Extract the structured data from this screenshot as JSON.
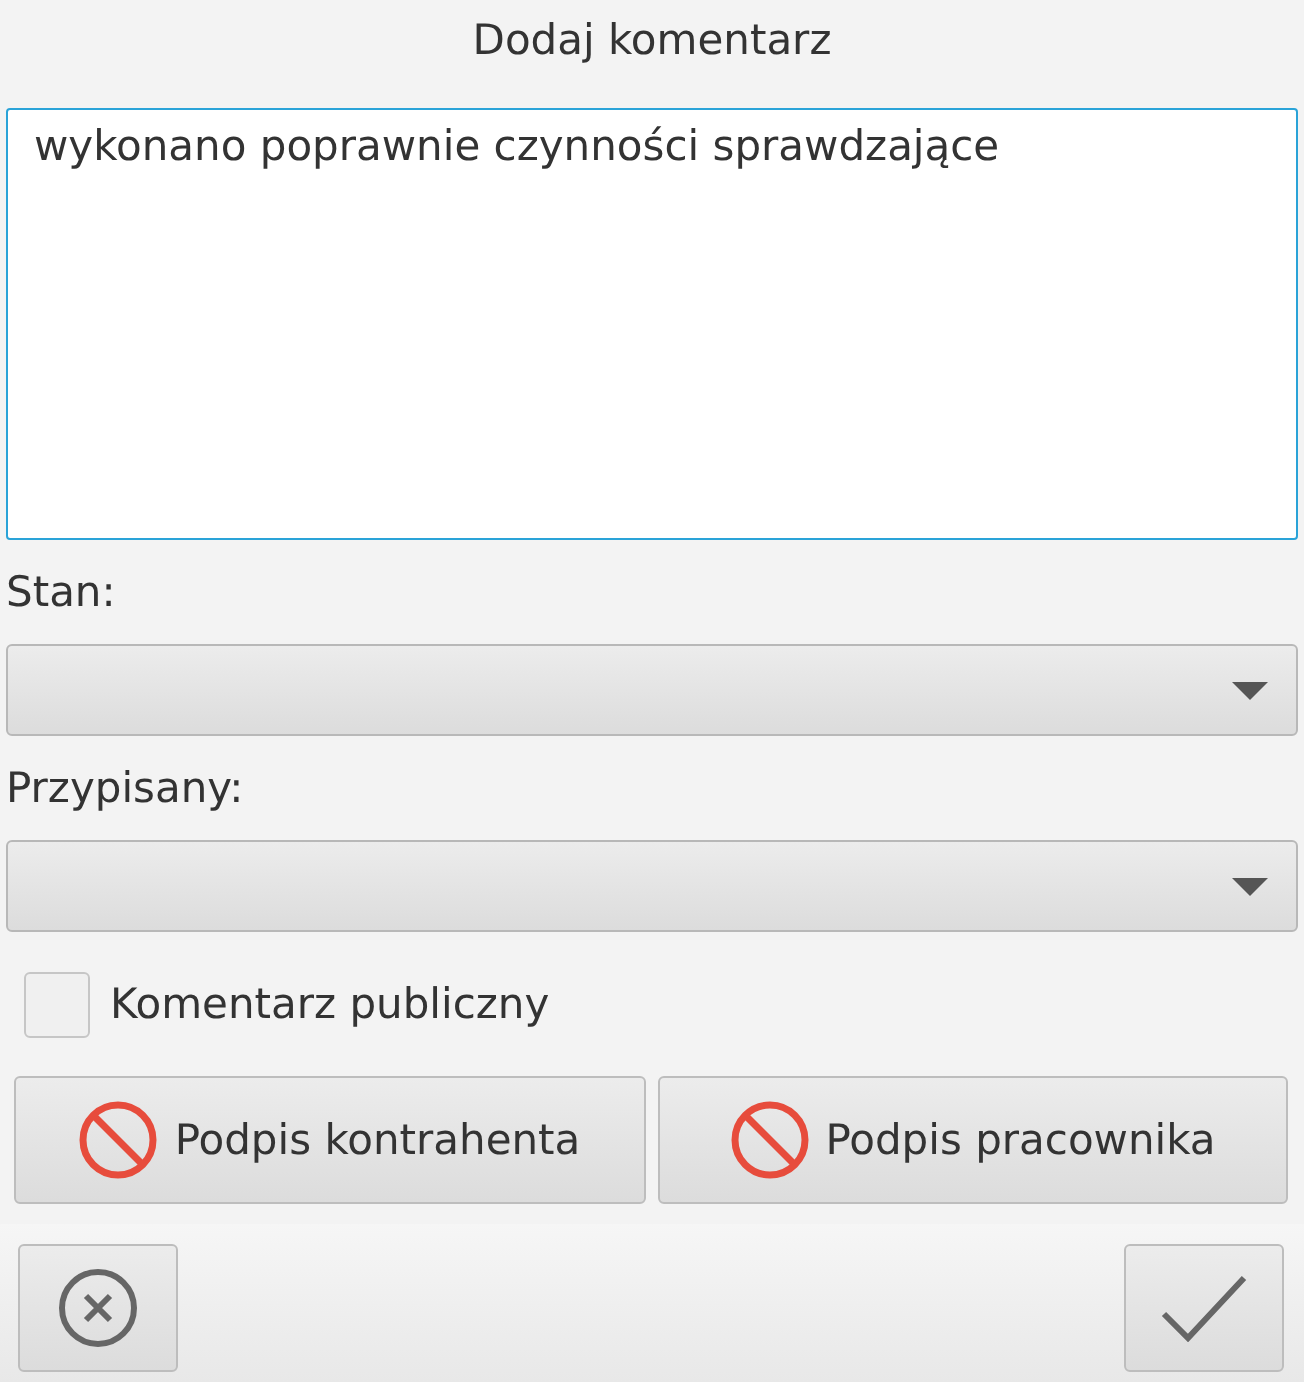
{
  "title": "Dodaj komentarz",
  "comment": {
    "value": "wykonano poprawnie czynności sprawdzające"
  },
  "fields": [
    {
      "label": "Stan:",
      "kind": "dropdown"
    },
    {
      "label": "Przypisany:",
      "kind": "dropdown"
    }
  ],
  "public_checkbox": {
    "label": "Komentarz publiczny",
    "checked": false
  },
  "signatures": [
    {
      "label": "Podpis kontrahenta",
      "signed": false
    },
    {
      "label": "Podpis pracownika",
      "signed": false
    }
  ],
  "footer": {
    "buttons": [
      {
        "kind": "cancel"
      },
      {
        "kind": "confirm"
      }
    ]
  }
}
